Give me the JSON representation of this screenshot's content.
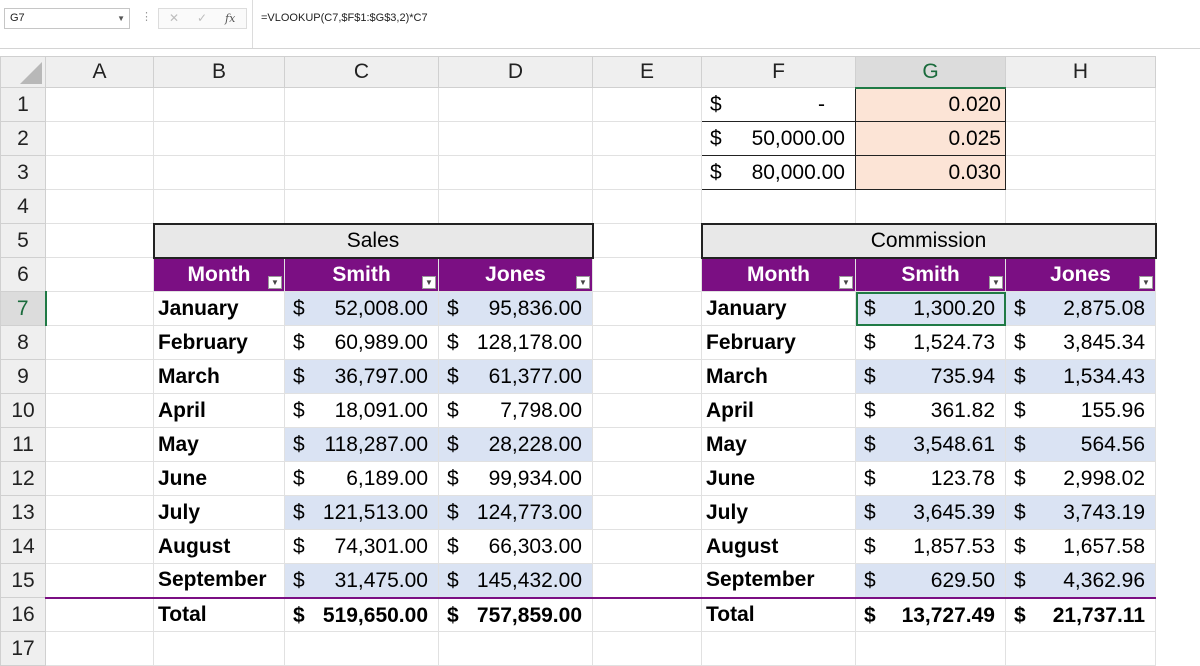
{
  "name_box": "G7",
  "formula": "=VLOOKUP(C7,$F$1:$G$3,2)*C7",
  "columns": [
    "A",
    "B",
    "C",
    "D",
    "E",
    "F",
    "G",
    "H"
  ],
  "rows": [
    "1",
    "2",
    "3",
    "4",
    "5",
    "6",
    "7",
    "8",
    "9",
    "10",
    "11",
    "12",
    "13",
    "14",
    "15",
    "16",
    "17"
  ],
  "lookup": [
    {
      "cur": "$",
      "amount": "-",
      "rate": "0.020"
    },
    {
      "cur": "$",
      "amount": "50,000.00",
      "rate": "0.025"
    },
    {
      "cur": "$",
      "amount": "80,000.00",
      "rate": "0.030"
    }
  ],
  "sales": {
    "title": "Sales",
    "headers": [
      "Month",
      "Smith",
      "Jones"
    ],
    "rows": [
      {
        "month": "January",
        "smith_cur": "$",
        "smith": "52,008.00",
        "jones_cur": "$",
        "jones": "95,836.00"
      },
      {
        "month": "February",
        "smith_cur": "$",
        "smith": "60,989.00",
        "jones_cur": "$",
        "jones": "128,178.00"
      },
      {
        "month": "March",
        "smith_cur": "$",
        "smith": "36,797.00",
        "jones_cur": "$",
        "jones": "61,377.00"
      },
      {
        "month": "April",
        "smith_cur": "$",
        "smith": "18,091.00",
        "jones_cur": "$",
        "jones": "7,798.00"
      },
      {
        "month": "May",
        "smith_cur": "$",
        "smith": "118,287.00",
        "jones_cur": "$",
        "jones": "28,228.00"
      },
      {
        "month": "June",
        "smith_cur": "$",
        "smith": "6,189.00",
        "jones_cur": "$",
        "jones": "99,934.00"
      },
      {
        "month": "July",
        "smith_cur": "$",
        "smith": "121,513.00",
        "jones_cur": "$",
        "jones": "124,773.00"
      },
      {
        "month": "August",
        "smith_cur": "$",
        "smith": "74,301.00",
        "jones_cur": "$",
        "jones": "66,303.00"
      },
      {
        "month": "September",
        "smith_cur": "$",
        "smith": "31,475.00",
        "jones_cur": "$",
        "jones": "145,432.00"
      }
    ],
    "total": {
      "label": "Total",
      "smith_cur": "$",
      "smith": "519,650.00",
      "jones_cur": "$",
      "jones": "757,859.00"
    }
  },
  "commission": {
    "title": "Commission",
    "headers": [
      "Month",
      "Smith",
      "Jones"
    ],
    "rows": [
      {
        "month": "January",
        "smith_cur": "$",
        "smith": "1,300.20",
        "jones_cur": "$",
        "jones": "2,875.08"
      },
      {
        "month": "February",
        "smith_cur": "$",
        "smith": "1,524.73",
        "jones_cur": "$",
        "jones": "3,845.34"
      },
      {
        "month": "March",
        "smith_cur": "$",
        "smith": "735.94",
        "jones_cur": "$",
        "jones": "1,534.43"
      },
      {
        "month": "April",
        "smith_cur": "$",
        "smith": "361.82",
        "jones_cur": "$",
        "jones": "155.96"
      },
      {
        "month": "May",
        "smith_cur": "$",
        "smith": "3,548.61",
        "jones_cur": "$",
        "jones": "564.56"
      },
      {
        "month": "June",
        "smith_cur": "$",
        "smith": "123.78",
        "jones_cur": "$",
        "jones": "2,998.02"
      },
      {
        "month": "July",
        "smith_cur": "$",
        "smith": "3,645.39",
        "jones_cur": "$",
        "jones": "3,743.19"
      },
      {
        "month": "August",
        "smith_cur": "$",
        "smith": "1,857.53",
        "jones_cur": "$",
        "jones": "1,657.58"
      },
      {
        "month": "September",
        "smith_cur": "$",
        "smith": "629.50",
        "jones_cur": "$",
        "jones": "4,362.96"
      }
    ],
    "total": {
      "label": "Total",
      "smith_cur": "$",
      "smith": "13,727.49",
      "jones_cur": "$",
      "jones": "21,737.11"
    }
  },
  "colors": {
    "header_purple": "#7b0f83",
    "band_blue": "#dae3f3",
    "rate_peach": "#fce4d6",
    "select_green": "#1f7a45"
  }
}
